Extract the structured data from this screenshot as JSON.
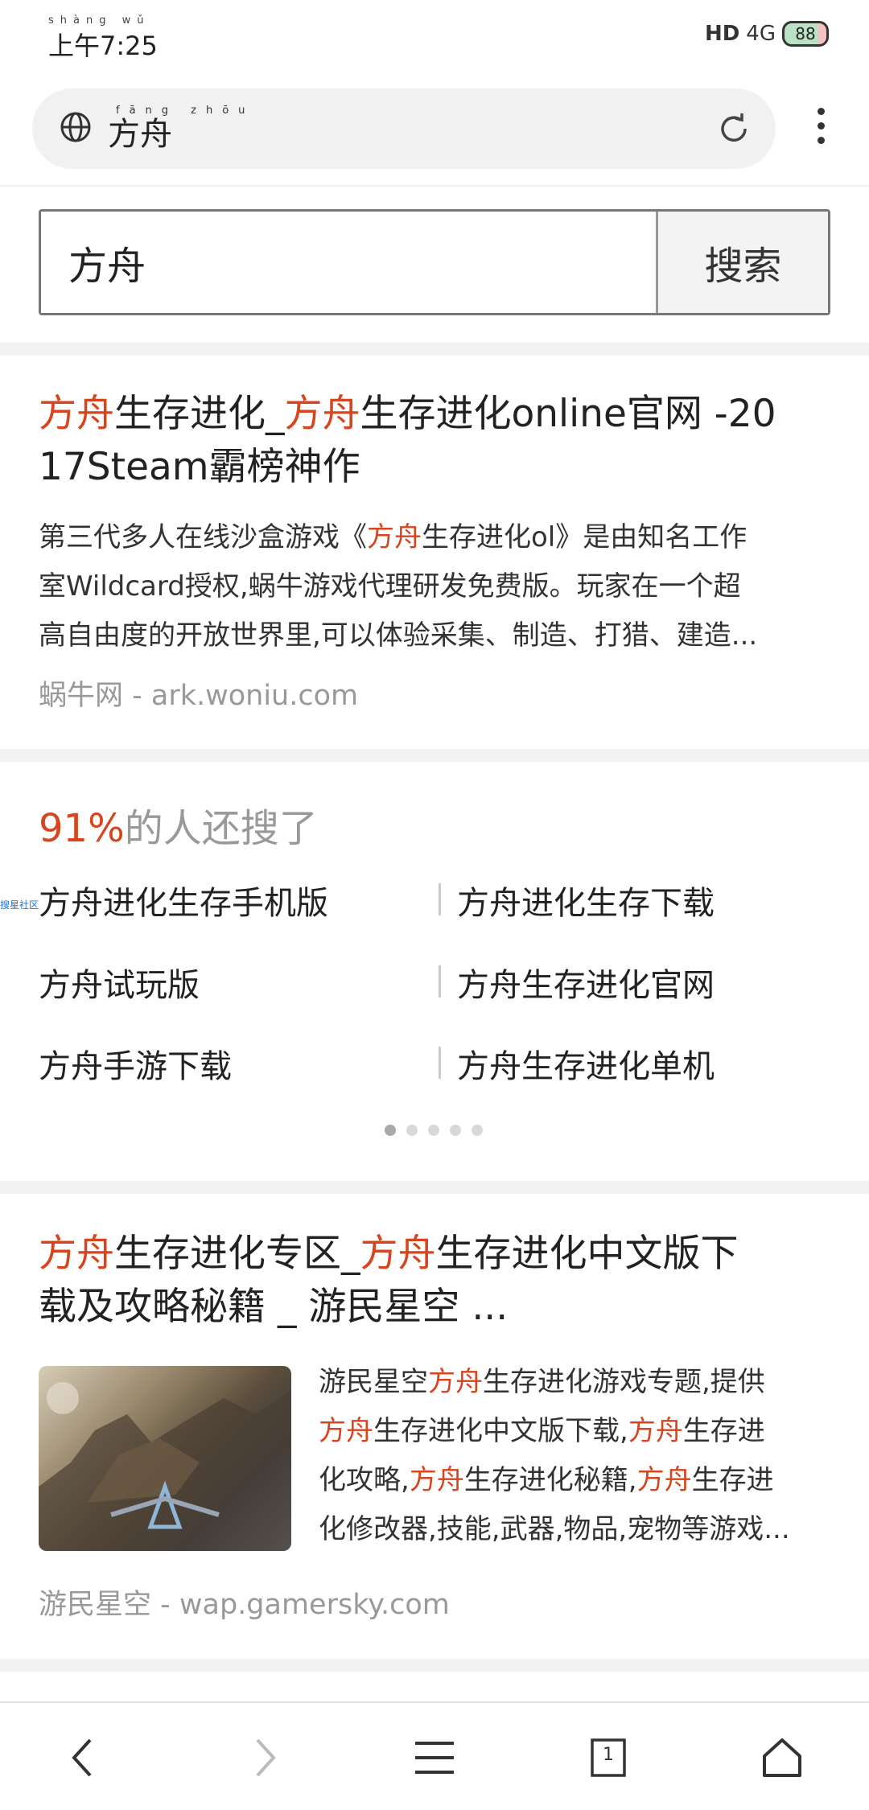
{
  "status_bar": {
    "time_pinyin": "shàng wǔ",
    "time": "上午7:25",
    "signal": "HD",
    "network": "4G",
    "battery": "88"
  },
  "address_bar": {
    "pinyin": "fāng zhōu",
    "title": "方舟"
  },
  "search": {
    "query": "方舟",
    "button_label": "搜索"
  },
  "result1": {
    "title_parts": [
      "方舟",
      "生存进化_",
      "方舟",
      "生存进化online官网 -20",
      "17Steam霸榜神作"
    ],
    "desc_parts": [
      "第三代多人在线沙盒游戏《",
      "方舟",
      "生存进化ol》是由知名工作",
      "室Wildcard授权,蜗牛游戏代理研发免费版。玩家在一个超",
      "高自由度的开放世界里,可以体验采集、制造、打猎、建造..."
    ],
    "source": "蜗牛网 - ark.woniu.com"
  },
  "related": {
    "percent": "91%",
    "heading_rest": "的人还搜了",
    "tag": "搜星社区",
    "items": [
      "方舟进化生存手机版",
      "方舟进化生存下载",
      "方舟试玩版",
      "方舟生存进化官网",
      "方舟手游下载",
      "方舟生存进化单机"
    ]
  },
  "result2": {
    "title_parts": [
      "方舟",
      "生存进化专区_",
      "方舟",
      "生存进化中文版下",
      "载及攻略秘籍 _ 游民星空 ..."
    ],
    "desc_parts": [
      "游民星空",
      "方舟",
      "生存进化游戏专题,提供",
      "方舟",
      "生存进化中文版下载,",
      "方舟",
      "生存进",
      "化攻略,",
      "方舟",
      "生存进化秘籍,",
      "方舟",
      "生存进",
      "化修改器,技能,武器,物品,宠物等游戏..."
    ],
    "source": "游民星空 - wap.gamersky.com"
  },
  "bottom_nav": {
    "tab_count": "1"
  }
}
